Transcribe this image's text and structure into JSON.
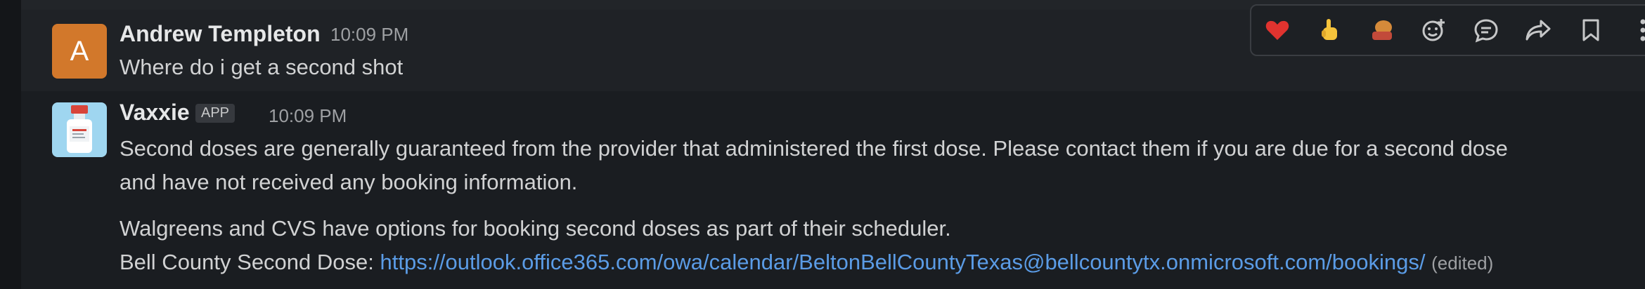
{
  "messages": [
    {
      "sender": "Andrew Templeton",
      "time": "10:09 PM",
      "avatar_letter": "A",
      "lines": [
        "Where do i get a second shot"
      ]
    },
    {
      "sender": "Vaxxie",
      "badge": "APP",
      "time": "10:09 PM",
      "lines": [
        "Second doses are generally guaranteed from the provider that administered the first dose.  Please contact them if you are due for a second dose",
        "and have not received any booking information.",
        "Walgreens and CVS have options for booking second doses as part of their scheduler.",
        "Bell County Second Dose: "
      ],
      "link": "https://outlook.office365.com/owa/calendar/BeltonBellCountyTexas@bellcountytx.onmicrosoft.com/bookings/",
      "edited": "(edited)"
    }
  ],
  "toolbar": {
    "icons": [
      "heart-reaction-icon",
      "point-up-reaction-icon",
      "bread-reaction-icon",
      "add-reaction-icon",
      "reply-thread-icon",
      "share-icon",
      "bookmark-icon",
      "more-actions-icon"
    ]
  },
  "colors": {
    "background": "#1a1d21",
    "link": "#5b9ce6",
    "avatar_andrew": "#d2782b",
    "avatar_vaxxie": "#9fd6f0"
  }
}
